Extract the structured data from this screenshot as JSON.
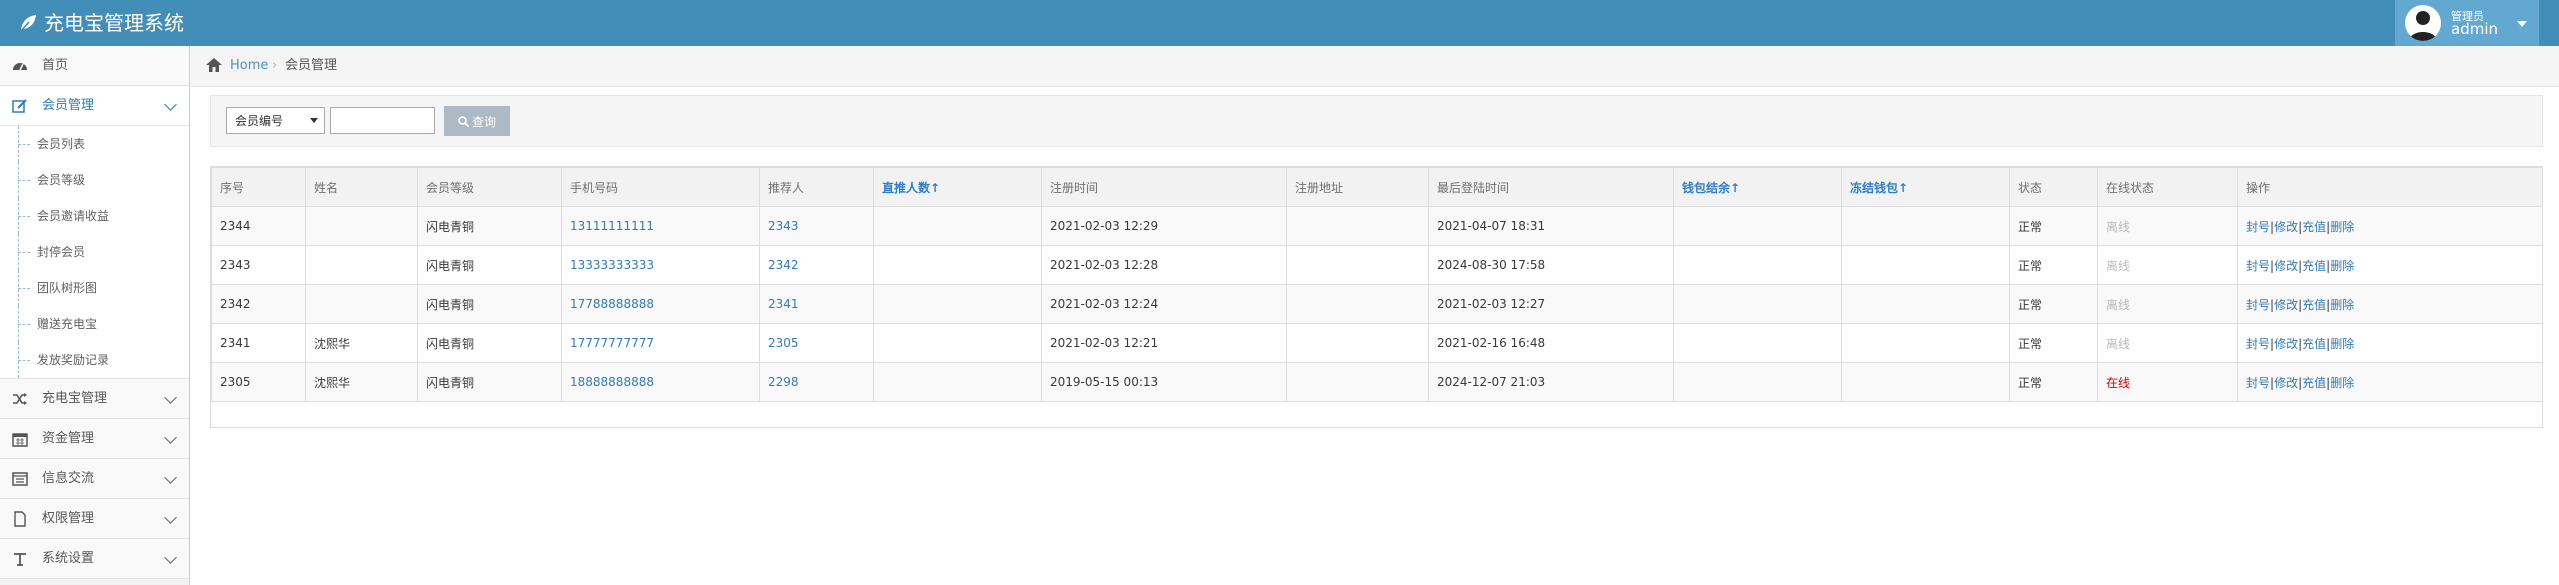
{
  "header": {
    "app_title": "充电宝管理系统",
    "user_role": "管理员",
    "user_name": "admin"
  },
  "sidebar": {
    "items": [
      {
        "label": "首页",
        "icon": "dashboard-icon"
      },
      {
        "label": "会员管理",
        "icon": "edit-icon",
        "open": true,
        "children": [
          "会员列表",
          "会员等级",
          "会员邀请收益",
          "封停会员",
          "团队树形图",
          "赠送充电宝",
          "发放奖励记录"
        ]
      },
      {
        "label": "充电宝管理",
        "icon": "shuffle-icon"
      },
      {
        "label": "资金管理",
        "icon": "calendar-icon"
      },
      {
        "label": "信息交流",
        "icon": "list-icon"
      },
      {
        "label": "权限管理",
        "icon": "file-icon"
      },
      {
        "label": "系统设置",
        "icon": "text-icon"
      }
    ]
  },
  "breadcrumb": {
    "home": "Home",
    "current": "会员管理"
  },
  "search": {
    "field_selected": "会员编号",
    "keyword_value": "",
    "button_label": "查询"
  },
  "table": {
    "headers": [
      "序号",
      "姓名",
      "会员等级",
      "手机号码",
      "推荐人",
      "直推人数↑",
      "注册时间",
      "注册地址",
      "最后登陆时间",
      "钱包结余↑",
      "冻结钱包↑",
      "状态",
      "在线状态",
      "操作"
    ],
    "actions": [
      "封号",
      "修改",
      "充值",
      "删除"
    ],
    "rows": [
      {
        "id": "2344",
        "name": "",
        "level": "闪电青铜",
        "phone": "13111111111",
        "referrer": "2343",
        "direct": "",
        "reg_time": "2021-02-03 12:29",
        "reg_addr": "",
        "last_login": "2021-04-07 18:31",
        "wallet": "",
        "frozen": "",
        "status": "正常",
        "online": "离线"
      },
      {
        "id": "2343",
        "name": "",
        "level": "闪电青铜",
        "phone": "13333333333",
        "referrer": "2342",
        "direct": "",
        "reg_time": "2021-02-03 12:28",
        "reg_addr": "",
        "last_login": "2024-08-30 17:58",
        "wallet": "",
        "frozen": "",
        "status": "正常",
        "online": "离线"
      },
      {
        "id": "2342",
        "name": "",
        "level": "闪电青铜",
        "phone": "17788888888",
        "referrer": "2341",
        "direct": "",
        "reg_time": "2021-02-03 12:24",
        "reg_addr": "",
        "last_login": "2021-02-03 12:27",
        "wallet": "",
        "frozen": "",
        "status": "正常",
        "online": "离线"
      },
      {
        "id": "2341",
        "name": "沈熙华",
        "level": "闪电青铜",
        "phone": "17777777777",
        "referrer": "2305",
        "direct": "",
        "reg_time": "2021-02-03 12:21",
        "reg_addr": "",
        "last_login": "2021-02-16 16:48",
        "wallet": "",
        "frozen": "",
        "status": "正常",
        "online": "离线"
      },
      {
        "id": "2305",
        "name": "沈熙华",
        "level": "闪电青铜",
        "phone": "18888888888",
        "referrer": "2298",
        "direct": "",
        "reg_time": "2019-05-15 00:13",
        "reg_addr": "",
        "last_login": "2024-12-07 21:03",
        "wallet": "",
        "frozen": "",
        "status": "正常",
        "online": "在线"
      }
    ]
  },
  "colors": {
    "navbar": "#438eb9",
    "user_box": "#62a8d1",
    "link": "#337ab7",
    "online": "#dd0000",
    "offline": "#bbbbbb"
  }
}
